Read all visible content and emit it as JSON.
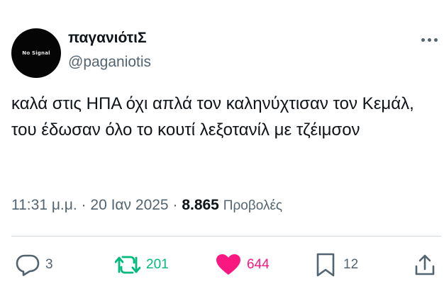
{
  "author": {
    "display_name": "παγανιότιΣ",
    "handle": "@paganiotis",
    "avatar_text": "No Signal"
  },
  "tweet": {
    "text": "καλά στις ΗΠΑ όχι απλά τον καληνύχτισαν τον Κεμάλ, του έδωσαν όλο το κουτί λεξοτανίλ με τζέιμσον"
  },
  "meta": {
    "time": "11:31 μ.μ.",
    "separator": "·",
    "date": "20 Ιαν 2025",
    "views_count": "8.865",
    "views_label": "Προβολές"
  },
  "actions": {
    "reply_count": "3",
    "retweet_count": "201",
    "like_count": "644",
    "bookmark_count": "12"
  },
  "colors": {
    "text_primary": "#0f1419",
    "text_secondary": "#536471",
    "retweet_green": "#00ba7c",
    "like_pink": "#f91880",
    "divider": "#cfd9de"
  },
  "icons": [
    "reply-icon",
    "retweet-icon",
    "like-icon",
    "bookmark-icon",
    "share-icon",
    "more-icon"
  ]
}
